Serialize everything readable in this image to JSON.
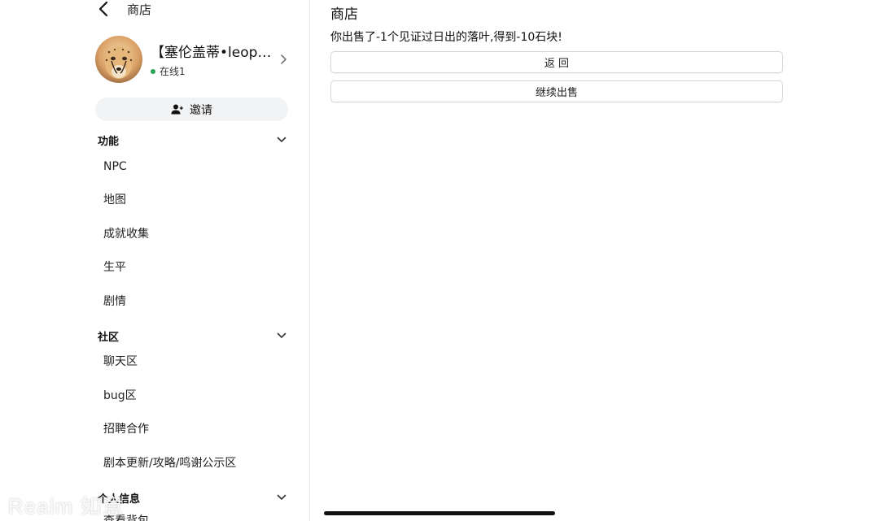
{
  "sidebar": {
    "back_title": "商店",
    "profile": {
      "name": "【塞伦盖蒂•leopa...",
      "status": "在线1"
    },
    "invite_label": "邀请",
    "sections": [
      {
        "title": "功能",
        "items": [
          "NPC",
          "地图",
          "成就收集",
          "生平",
          "剧情"
        ]
      },
      {
        "title": "社区",
        "items": [
          "聊天区",
          "bug区",
          "招聘合作",
          "剧本更新/攻略/鸣谢公示区"
        ]
      },
      {
        "title": "个人信息",
        "items": [
          "查看背包"
        ]
      }
    ]
  },
  "main": {
    "title": "商店",
    "message": "你出售了-1个见证过日出的落叶,得到-10石块!",
    "buttons": {
      "back": "返 回",
      "continue_sell": "继续出售"
    }
  },
  "watermark": "Realm 如意",
  "colors": {
    "online": "#2aa558",
    "button_border": "#d6d6d6",
    "invite_bg": "#f2f3f5"
  },
  "icons": {
    "back": "chevron-left-icon",
    "profile_arrow": "chevron-right-icon",
    "invite": "person-icon",
    "section_toggle": "chevron-down-icon"
  }
}
